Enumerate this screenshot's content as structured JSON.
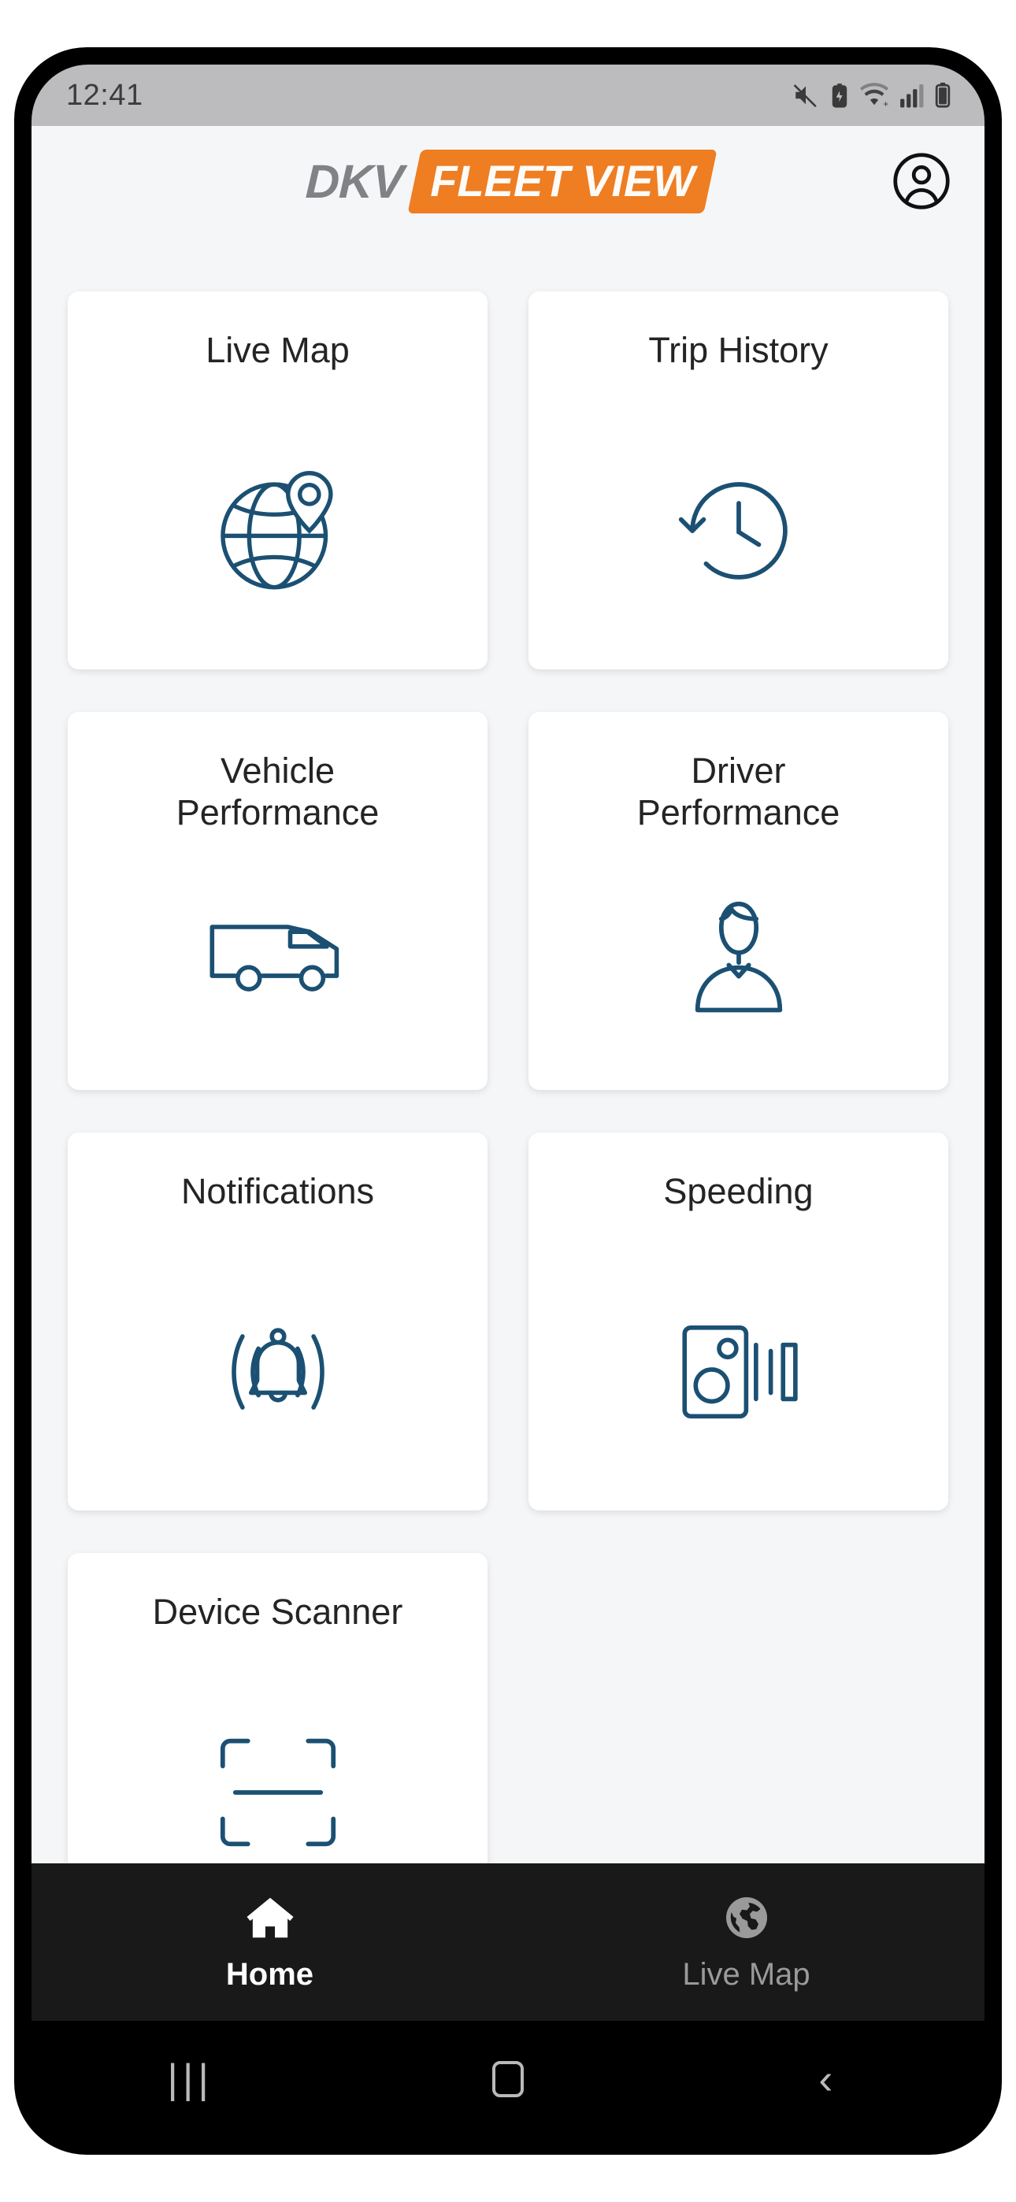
{
  "status_bar": {
    "time": "12:41",
    "icons": [
      "mute-icon",
      "battery-saver-icon",
      "wifi-icon",
      "signal-icon",
      "battery-icon"
    ]
  },
  "header": {
    "brand_primary": "DKV",
    "brand_badge": "FLEET VIEW",
    "account_icon": "account-circle-icon",
    "brand_gray": "#808285",
    "brand_orange": "#ef7d22"
  },
  "theme": {
    "icon_blue": "#1b5073",
    "page_background": "#f5f6f8",
    "card_background": "#ffffff",
    "tab_bar_background": "#191919"
  },
  "main": {
    "tiles": [
      {
        "label": "Live Map",
        "icon": "globe-pin-icon"
      },
      {
        "label": "Trip History",
        "icon": "history-clock-icon"
      },
      {
        "label": "Vehicle\nPerformance",
        "icon": "van-icon"
      },
      {
        "label": "Driver\nPerformance",
        "icon": "driver-person-icon"
      },
      {
        "label": "Notifications",
        "icon": "bell-ringing-icon"
      },
      {
        "label": "Speeding",
        "icon": "speed-camera-icon"
      },
      {
        "label": "Device Scanner",
        "icon": "scanner-icon"
      }
    ]
  },
  "bottom_tabs": [
    {
      "label": "Home",
      "icon": "home-icon",
      "active": true
    },
    {
      "label": "Live Map",
      "icon": "globe-icon",
      "active": false
    }
  ],
  "android_nav": {
    "recents": "|||",
    "home": "○",
    "back": "‹"
  }
}
